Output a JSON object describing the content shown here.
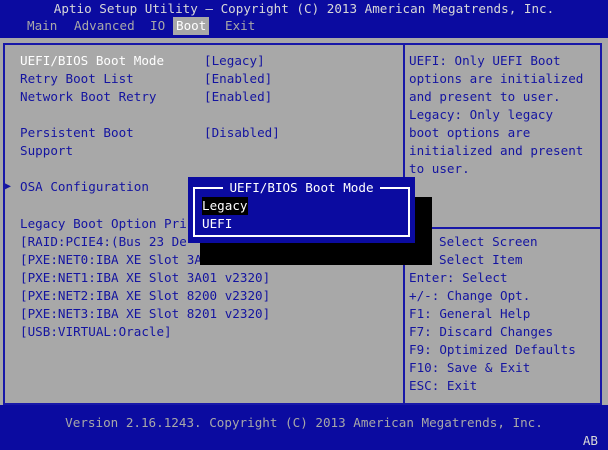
{
  "header": {
    "title": "Aptio Setup Utility – Copyright (C) 2013 American Megatrends, Inc.",
    "tabs": [
      {
        "label": "Main"
      },
      {
        "label": "Advanced"
      },
      {
        "label": "IO"
      },
      {
        "label": "Boot",
        "active": true
      },
      {
        "label": "Exit"
      }
    ]
  },
  "settings": [
    {
      "label": "UEFI/BIOS Boot Mode",
      "value": "[Legacy]"
    },
    {
      "label": "Retry Boot List",
      "value": "[Enabled]"
    },
    {
      "label": "Network Boot Retry",
      "value": "[Enabled]"
    },
    {
      "label": "Persistent Boot",
      "label2": "Support",
      "value": "[Disabled]"
    },
    {
      "label": "OSA Configuration"
    }
  ],
  "legacy": {
    "heading": "Legacy Boot Option Pri",
    "items": [
      "[RAID:PCIE4:(Bus 23 De",
      "[PXE:NET0:IBA XE Slot 3A",
      "[PXE:NET1:IBA XE Slot 3A01 v2320]",
      "[PXE:NET2:IBA XE Slot 8200 v2320]",
      "[PXE:NET3:IBA XE Slot 8201 v2320]",
      "[USB:VIRTUAL:Oracle]"
    ]
  },
  "help": [
    "UEFI: Only UEFI Boot",
    "options are initialized",
    "and present to user.",
    "Legacy: Only legacy",
    "boot options are",
    "initialized and present",
    "to user."
  ],
  "keys": [
    "Select Screen",
    "Select Item",
    "Enter: Select",
    "+/-: Change Opt.",
    "F1: General Help",
    "F7: Discard Changes",
    "F9: Optimized Defaults",
    "F10: Save & Exit",
    "ESC: Exit"
  ],
  "popup": {
    "title": "UEFI/BIOS Boot Mode",
    "options": [
      "Legacy",
      "UEFI"
    ],
    "selected": "Legacy"
  },
  "footer": {
    "version": "Version 2.16.1243. Copyright (C) 2013 American Megatrends, Inc.",
    "indicator": "AB"
  },
  "colors": {
    "blue": "#0b0ba0",
    "gray": "#a8a8a8"
  }
}
